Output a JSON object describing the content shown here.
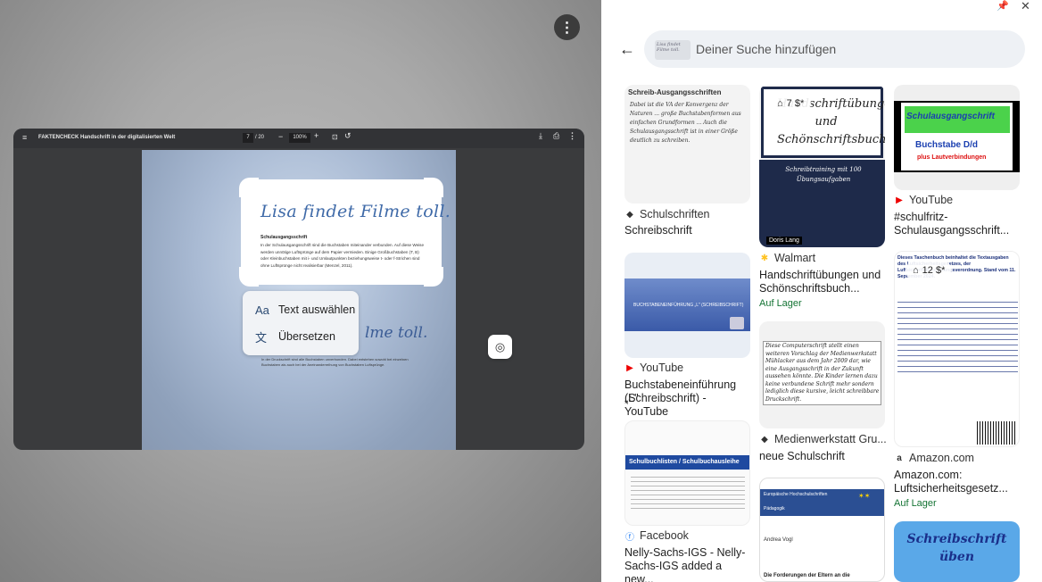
{
  "viewer": {
    "title": "FAKTENCHECK Handschrift in der digitalisierten Welt",
    "page": "7",
    "total": "/ 20",
    "zoom": "100%"
  },
  "selection": {
    "handwriting": "Lisa findet Filme toll.",
    "heading": "Schulausgangsschrift",
    "body": "In der Schulausgangsschrift sind die Buchstaben miteinander verbunden. Auf diese Weise werden unnötige Luftsprünge auf dem Papier vermieden. Einige Großbuchstaben (T, B) oder Kleinbuchstaben mit i- und Umlautpunkten beziehungsweise t- oder f-Strichen sind ohne Luftsprünge nicht realisierbar (Menzel, 2011).",
    "lower_script": "lme toll.",
    "lower_body": "In der Druckschrift sind alle Buchstaben unverbunden. Dabei entstehen sowohl bei einzelnen Buchstaben als auch bei der Aneinanderreihung von Buchstaben Luftsprünge."
  },
  "context_menu": {
    "select_text": "Text auswählen",
    "translate": "Übersetzen"
  },
  "search": {
    "placeholder": "Deiner Suche hinzufügen",
    "thumb_text": "Lisa findet Filme toll."
  },
  "results": [
    {
      "source": "Schulschriften",
      "title": "Schreibschrift",
      "img_heading": "Schreib-Ausgangsschriften",
      "img_text": "Dabei ist die VA der Konvergenz der Naturen ... große Buchstabenformen aus einfachen Grundformen ... Auch die Schulausgangsschrift ist in einer Größe deutlich zu schreiben."
    },
    {
      "source": "Walmart",
      "title_line1": "Handschriftübungen und",
      "title_line2": "Schönschriftsbuch...",
      "stock": "Auf Lager",
      "price": "7 $*",
      "img_title": "Handschriftübungen und Schönschriftsbuch",
      "img_sub": "Schreibtraining mit 100 Übungsaufgaben",
      "img_author": "Doris Lang"
    },
    {
      "source": "YouTube",
      "title_line1": "#schulfritz-",
      "title_line2": "Schulausgangsschrift...",
      "img_main": "Schulausgangschrift",
      "img_line1": "Buchstabe D/d",
      "img_line2": "plus Lautverbindungen"
    },
    {
      "source": "YouTube",
      "title_line1": "Buchstabeneinführung „L\"",
      "title_line2": "(Schreibschrift) - YouTube",
      "img_text": "BUCHSTABENEINFÜHRUNG „L\" (SCHREIBSCHRIFT)"
    },
    {
      "source": "Medienwerkstatt Gru...",
      "title": "neue Schulschrift",
      "img_text": "Diese Computerschrift stellt einen weiteren Vorschlag der Medienwerkstatt Mühlacker aus dem Jahr 2009 dar, wie eine Ausgangsschrift in der Zukunft aussehen könnte. Die Kinder lernen dazu keine verbundene Schrift mehr sondern lediglich diese kursive, leicht schreibbare Druckschrift."
    },
    {
      "source": "Amazon.com",
      "title_line1": "Amazon.com:",
      "title_line2": "Luftsicherheitsgesetz...",
      "stock": "Auf Lager",
      "price": "12 $*",
      "img_text": "Dieses Taschenbuch beinhaltet die Textausgaben des Luftsicherheitsgesetzes, der Luftsicherheitsschulungsverordnung. Stand vom 11. September 2024."
    },
    {
      "source": "Facebook",
      "title_line1": "Nelly-Sachs-IGS - Nelly-",
      "title_line2": "Sachs-IGS added a new...",
      "img_heading": "Schulbuchlisten / Schulbuchausleihe"
    },
    {
      "img_heading": "Europäische Hochschulschriften",
      "img_sub": "Pädagogik",
      "img_author": "Andrea Vogl",
      "img_bottom": "Die Forderungen der Eltern an die"
    },
    {
      "img_text": "Schreibschrift üben"
    }
  ]
}
